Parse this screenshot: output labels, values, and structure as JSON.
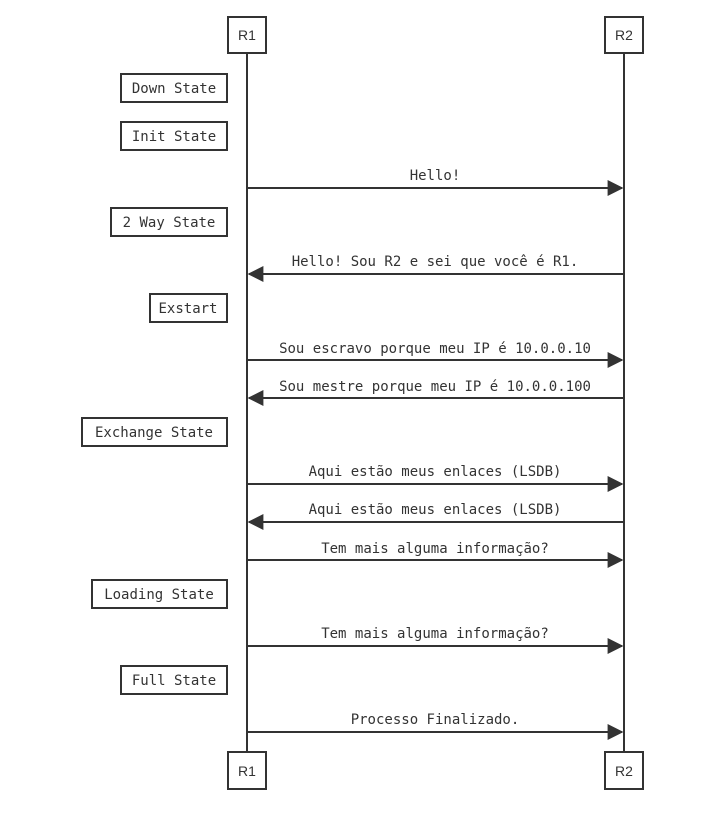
{
  "diagram": {
    "type": "sequence",
    "participants": [
      {
        "id": "r1",
        "label": "R1"
      },
      {
        "id": "r2",
        "label": "R2"
      }
    ],
    "colors": {
      "stroke": "#333333",
      "text": "#333333",
      "background": "#ffffff"
    },
    "steps": [
      {
        "kind": "note",
        "text": "Down State"
      },
      {
        "kind": "note",
        "text": "Init State"
      },
      {
        "kind": "message",
        "from": "r1",
        "to": "r2",
        "text": "Hello!"
      },
      {
        "kind": "note",
        "text": "2 Way State"
      },
      {
        "kind": "message",
        "from": "r2",
        "to": "r1",
        "text": "Hello! Sou R2 e sei que você é R1."
      },
      {
        "kind": "note",
        "text": "Exstart"
      },
      {
        "kind": "message",
        "from": "r1",
        "to": "r2",
        "text": "Sou escravo porque meu IP é 10.0.0.10"
      },
      {
        "kind": "message",
        "from": "r2",
        "to": "r1",
        "text": "Sou mestre porque meu IP é 10.0.0.100"
      },
      {
        "kind": "note",
        "text": "Exchange State"
      },
      {
        "kind": "message",
        "from": "r1",
        "to": "r2",
        "text": "Aqui estão meus enlaces (LSDB)"
      },
      {
        "kind": "message",
        "from": "r2",
        "to": "r1",
        "text": "Aqui estão meus enlaces (LSDB)"
      },
      {
        "kind": "message",
        "from": "r1",
        "to": "r2",
        "text": "Tem mais alguma informação?"
      },
      {
        "kind": "note",
        "text": "Loading State"
      },
      {
        "kind": "message",
        "from": "r1",
        "to": "r2",
        "text": "Tem mais alguma informação?"
      },
      {
        "kind": "note",
        "text": "Full State"
      },
      {
        "kind": "message",
        "from": "r1",
        "to": "r2",
        "text": "Processo Finalizado."
      }
    ]
  }
}
